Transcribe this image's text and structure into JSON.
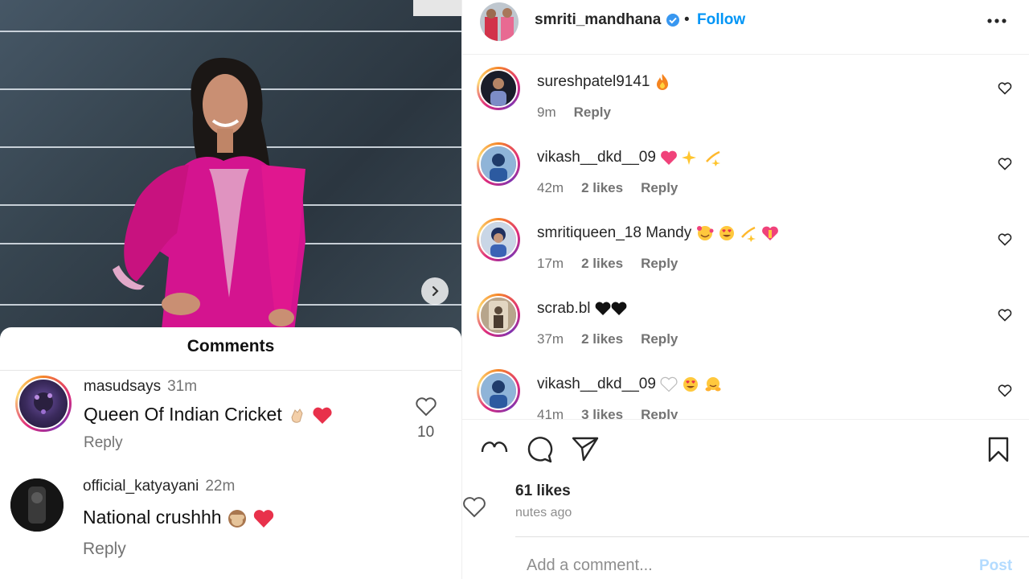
{
  "left_panel": {
    "comments_sheet_title": "Comments",
    "comments": [
      {
        "username": "masudsays",
        "time": "31m",
        "text": "Queen Of Indian Cricket",
        "reply_label": "Reply",
        "like_count": "10"
      },
      {
        "username": "official_katyayani",
        "time": "22m",
        "text": "National crushhh",
        "reply_label": "Reply"
      }
    ]
  },
  "post": {
    "username": "smriti_mandhana",
    "separator": "•",
    "follow_label": "Follow",
    "comments": [
      {
        "username": "sureshpatel9141",
        "text": "",
        "time": "9m",
        "likes": "",
        "reply_label": "Reply"
      },
      {
        "username": "vikash__dkd__09",
        "text": "",
        "time": "42m",
        "likes": "2 likes",
        "reply_label": "Reply"
      },
      {
        "username": "smritiqueen_18",
        "text": "Mandy",
        "time": "17m",
        "likes": "2 likes",
        "reply_label": "Reply"
      },
      {
        "username": "scrab.bl",
        "text": "",
        "time": "37m",
        "likes": "2 likes",
        "reply_label": "Reply"
      },
      {
        "username": "vikash__dkd__09",
        "text": "",
        "time": "41m",
        "likes": "3 likes",
        "reply_label": "Reply"
      }
    ],
    "likes_count": "61 likes",
    "time_ago": "nutes ago",
    "add_comment_placeholder": "Add a comment...",
    "post_button_label": "Post"
  },
  "colors": {
    "follow_blue": "#0095f6",
    "verified_blue": "#3897f0",
    "dress_magenta": "#d4148f",
    "post_button_disabled": "#b3dbff"
  }
}
